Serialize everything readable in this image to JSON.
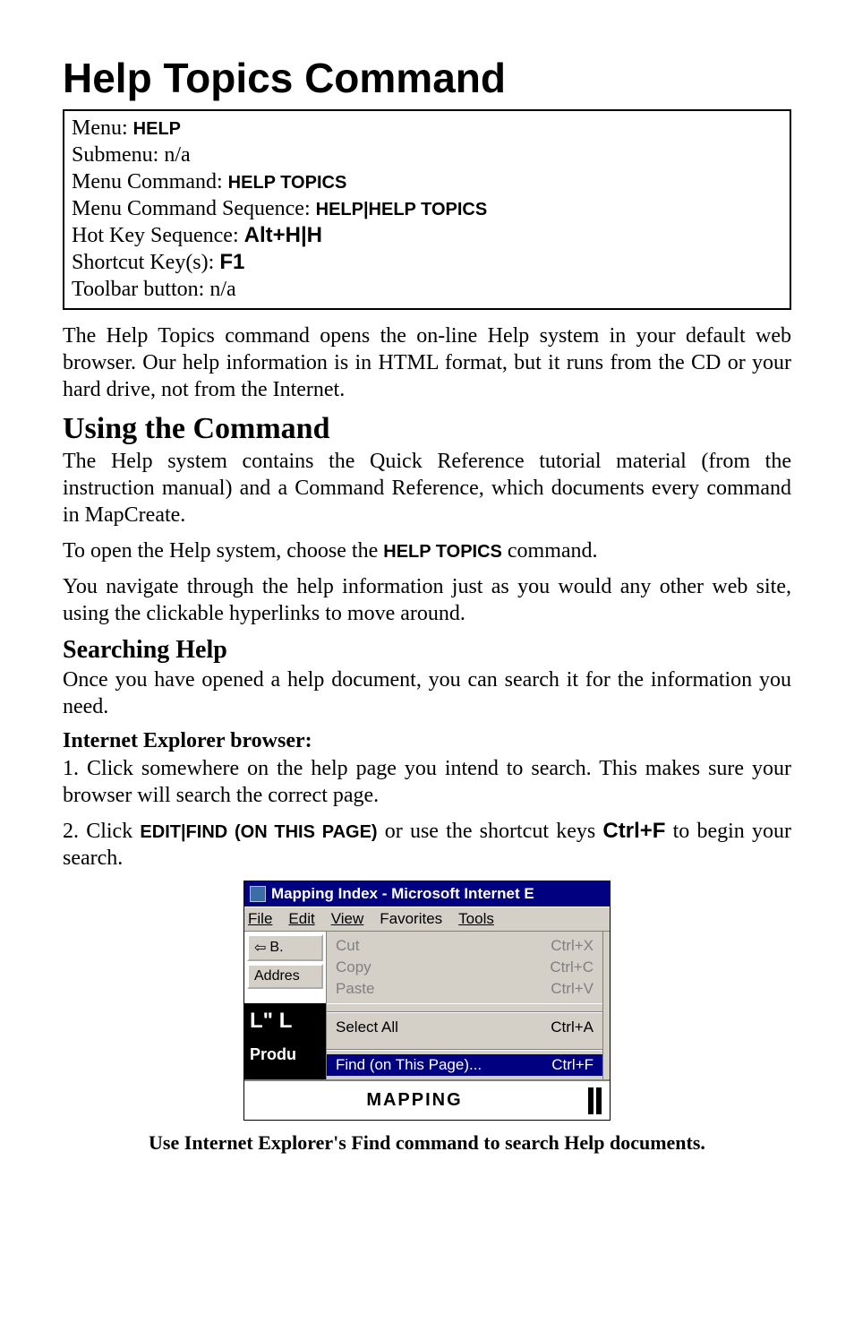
{
  "title": "Help Topics Command",
  "info": {
    "menu_label": "Menu: ",
    "menu_value": "HELP",
    "submenu_label": "Submenu: ",
    "submenu_value": "n/a",
    "command_label": "Menu Command: ",
    "command_value": "HELP TOPICS",
    "sequence_label": "Menu Command Sequence: ",
    "sequence_value": "HELP|HELP TOPICS",
    "hotkey_label": "Hot Key Sequence: ",
    "hotkey_value": "Alt+H|H",
    "shortcut_label": "Shortcut Key(s): ",
    "shortcut_value": "F1",
    "toolbar_label": "Toolbar button: ",
    "toolbar_value": "n/a"
  },
  "para1": "The Help Topics command opens the on-line Help system in your default web browser. Our help information is in HTML format, but it runs from the CD or your hard drive, not from the Internet.",
  "h2": "Using the Command",
  "para2": "The Help system contains the Quick Reference tutorial material (from the instruction manual) and a Command Reference, which documents every command in MapCreate.",
  "para3_a": "To open the Help system, choose the ",
  "para3_b": "HELP TOPICS",
  "para3_c": " command.",
  "para4": "You navigate through the help information just as you would any other web site, using the clickable hyperlinks to move around.",
  "h3": "Searching Help",
  "para5": "Once you have opened a help document, you can search it for the information you need.",
  "h4": "Internet Explorer browser:",
  "step1": "1. Click somewhere on the help page you intend to search. This makes sure your browser will search the correct page.",
  "step2_a": "2. Click ",
  "step2_b": "EDIT|FIND (ON THIS PAGE)",
  "step2_c": " or use the shortcut keys ",
  "step2_d": "Ctrl+F",
  "step2_e": " to begin your search.",
  "win": {
    "title": "Mapping Index - Microsoft Internet E",
    "menus": {
      "file": "File",
      "edit": "Edit",
      "view": "View",
      "favorites": "Favorites",
      "tools": "Tools"
    },
    "back_btn": "B.",
    "address": "Addres",
    "editmenu": {
      "cut": "Cut",
      "cut_sc": "Ctrl+X",
      "copy": "Copy",
      "copy_sc": "Ctrl+C",
      "paste": "Paste",
      "paste_sc": "Ctrl+V",
      "selectall": "Select All",
      "selectall_sc": "Ctrl+A",
      "find": "Find (on This Page)...",
      "find_sc": "Ctrl+F"
    },
    "logo": "L\" L",
    "produ": "Produ",
    "mapping": "MAPPING"
  },
  "caption": "Use Internet Explorer's Find command to search Help documents."
}
